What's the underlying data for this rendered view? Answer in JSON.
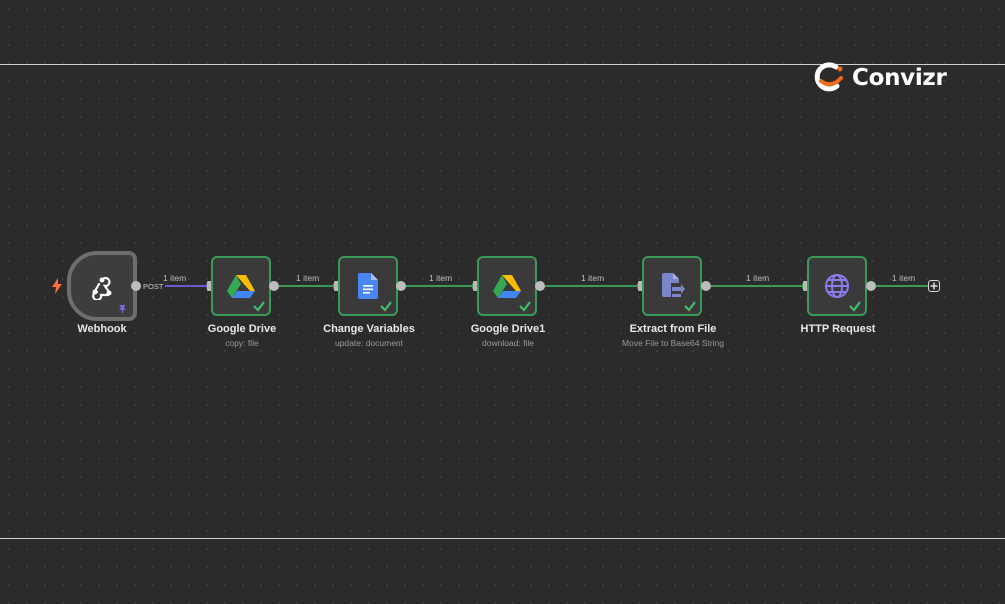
{
  "brand": {
    "name": "Convizr",
    "accent_color": "#f26b1d"
  },
  "trigger": {
    "bolt_icon_color": "#ff6d3f"
  },
  "nodes": [
    {
      "title": "Webhook",
      "subtitle": "",
      "icon": "webhook-icon",
      "status": "trigger"
    },
    {
      "title": "Google Drive",
      "subtitle": "copy: file",
      "icon": "google-drive-icon",
      "status": "success"
    },
    {
      "title": "Change Variables",
      "subtitle": "update: document",
      "icon": "google-docs-icon",
      "status": "success"
    },
    {
      "title": "Google Drive1",
      "subtitle": "download: file",
      "icon": "google-drive-icon",
      "status": "success"
    },
    {
      "title": "Extract from File",
      "subtitle": "Move File to Base64 String",
      "icon": "extract-file-icon",
      "status": "success"
    },
    {
      "title": "HTTP Request",
      "subtitle": "",
      "icon": "globe-icon",
      "status": "success"
    }
  ],
  "connections": [
    {
      "label": "1 item",
      "output": "POST"
    },
    {
      "label": "1 item"
    },
    {
      "label": "1 item"
    },
    {
      "label": "1 item"
    },
    {
      "label": "1 item"
    },
    {
      "label": "1 item"
    }
  ],
  "colors": {
    "canvas": "#2b2b2b",
    "success_border": "#3a9a5a",
    "success_edge": "#3a9a5a",
    "trigger_edge": "#6a5acd",
    "check": "#3fbf6a"
  }
}
